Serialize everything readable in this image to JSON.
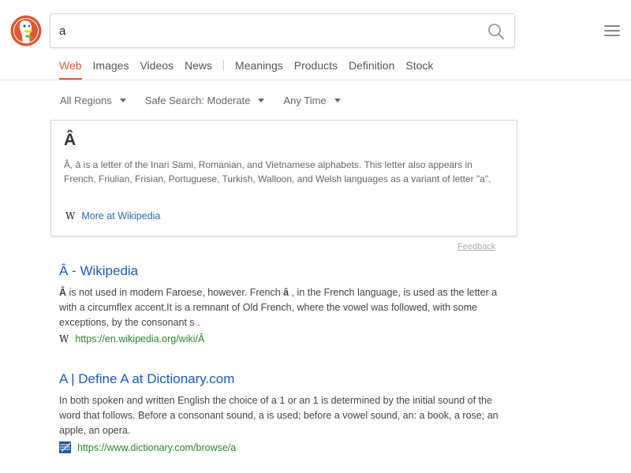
{
  "search": {
    "query": "a"
  },
  "tabs": [
    {
      "label": "Web",
      "active": true
    },
    {
      "label": "Images"
    },
    {
      "label": "Videos"
    },
    {
      "label": "News"
    },
    {
      "label": "Meanings"
    },
    {
      "label": "Products"
    },
    {
      "label": "Definition"
    },
    {
      "label": "Stock"
    }
  ],
  "filters": {
    "region": "All Regions",
    "safe_search": "Safe Search: Moderate",
    "time": "Any Time"
  },
  "infobox": {
    "title": "Â",
    "text": "Â, â is a letter of the Inari Sami, Romanian, and Vietnamese alphabets. This letter also appears in French, Friulian, Frisian, Portuguese, Turkish, Walloon, and Welsh languages as a variant of letter \"a\".",
    "more_link": "More at Wikipedia"
  },
  "feedback": "Feedback",
  "results": [
    {
      "title": "Â - Wikipedia",
      "snippet_bold": "Â",
      "snippet_part1": " is not used in modern Faroese, however. French ",
      "snippet_bold2": "â",
      "snippet_part2": " , in the French language, is used as the letter a with a circumflex accent.It is a remnant of Old French, where the vowel was followed, with some exceptions, by the consonant s .",
      "url": "https://en.wikipedia.org/wiki/Â",
      "favicon": "wikipedia-icon"
    },
    {
      "title": "A | Define A at Dictionary.com",
      "snippet": "In both spoken and written English the choice of a 1 or an 1 is determined by the initial sound of the word that follows. Before a consonant sound, a is used; before a vowel sound, an: a book, a rose; an apple, an opera.",
      "url": "https://www.dictionary.com/browse/a",
      "favicon": "dictionary-icon"
    }
  ],
  "colors": {
    "accent": "#de5833",
    "link": "#1a5ab8",
    "url": "#29862c"
  }
}
